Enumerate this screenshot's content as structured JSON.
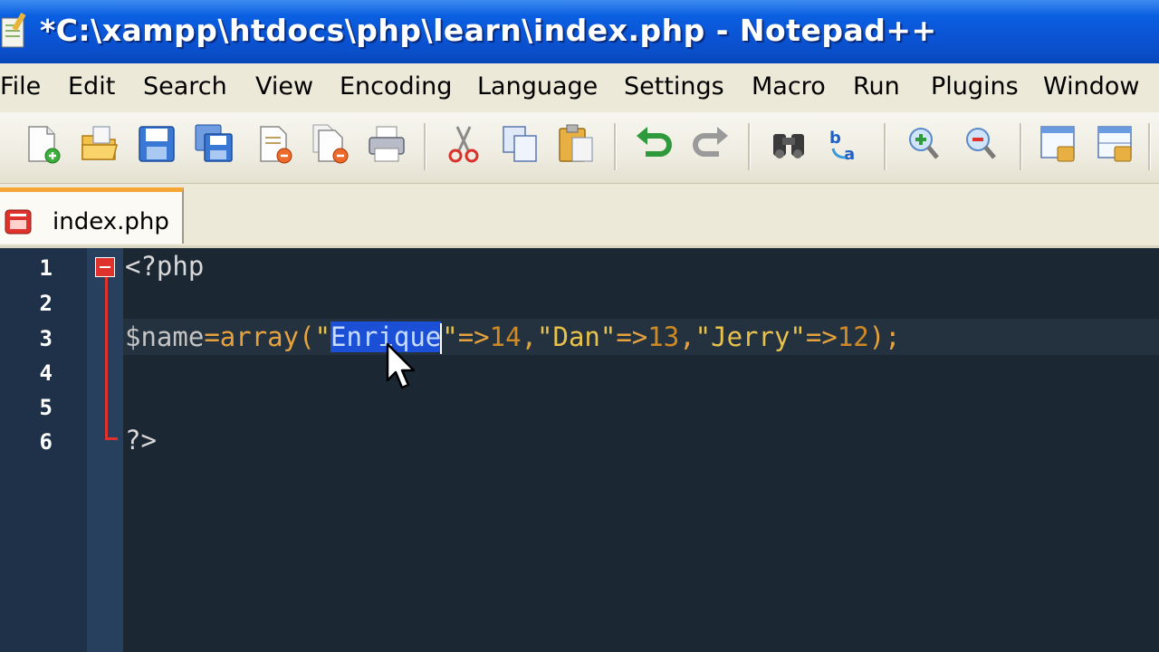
{
  "window": {
    "title": "*C:\\xampp\\htdocs\\php\\learn\\index.php - Notepad++"
  },
  "menu": {
    "items": [
      "File",
      "Edit",
      "Search",
      "View",
      "Encoding",
      "Language",
      "Settings",
      "Macro",
      "Run",
      "Plugins",
      "Window"
    ]
  },
  "toolbar": {
    "buttons": [
      "new-file-icon",
      "open-file-icon",
      "save-icon",
      "save-all-icon",
      "close-icon",
      "close-all-icon",
      "print-icon",
      "cut-icon",
      "copy-icon",
      "paste-icon",
      "undo-icon",
      "redo-icon",
      "find-icon",
      "replace-icon",
      "zoom-in-icon",
      "zoom-out-icon",
      "sync-vertical-icon",
      "sync-horizontal-icon"
    ]
  },
  "tabs": [
    {
      "label": "index.php",
      "modified": true
    }
  ],
  "editor": {
    "line_numbers": [
      "1",
      "2",
      "3",
      "4",
      "5",
      "6"
    ],
    "lines": {
      "l1": "<?php",
      "l3_var": "$name",
      "l3_eq": "=",
      "l3_fn": "array",
      "l3_paren_open": "(",
      "l3_q1": "\"",
      "l3_selected": "Enrique",
      "l3_q2": "\"",
      "l3_arrow1": "=>",
      "l3_n1": "14",
      "l3_c1": ",",
      "l3_s2": "\"Dan\"",
      "l3_arrow2": "=>",
      "l3_n2": "13",
      "l3_c2": ",",
      "l3_s3": "\"Jerry\"",
      "l3_arrow3": "=>",
      "l3_n3": "12",
      "l3_end": ");",
      "l6": "?>"
    },
    "selection": "Enrique"
  },
  "colors": {
    "title_bar": "#0a55d6",
    "editor_bg": "#1b2733",
    "selection": "#1a4fd6",
    "fold_marker": "#e0322c",
    "tab_accent": "#f7a635"
  }
}
